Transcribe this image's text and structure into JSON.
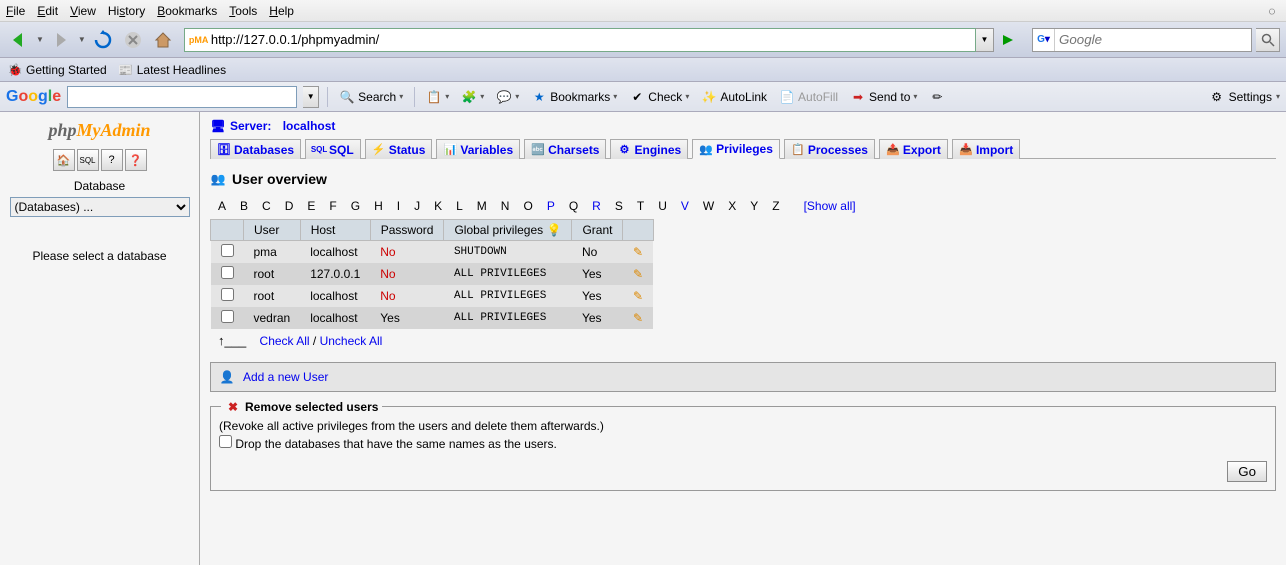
{
  "menu": {
    "file": "File",
    "edit": "Edit",
    "view": "View",
    "history": "History",
    "bookmarks": "Bookmarks",
    "tools": "Tools",
    "help": "Help"
  },
  "nav": {
    "url": "http://127.0.0.1/phpmyadmin/",
    "search_placeholder": "Google"
  },
  "bookmarks": {
    "getting_started": "Getting Started",
    "latest": "Latest Headlines"
  },
  "gbar": {
    "search": "Search",
    "bookmarks": "Bookmarks",
    "check": "Check",
    "autolink": "AutoLink",
    "autofill": "AutoFill",
    "sendto": "Send to",
    "settings": "Settings"
  },
  "sidebar": {
    "db_label": "Database",
    "db_select": "(Databases) ...",
    "hint": "Please select a database"
  },
  "server": {
    "label": "Server:",
    "name": "localhost"
  },
  "tabs": {
    "databases": "Databases",
    "sql": "SQL",
    "status": "Status",
    "variables": "Variables",
    "charsets": "Charsets",
    "engines": "Engines",
    "privileges": "Privileges",
    "processes": "Processes",
    "export": "Export",
    "import": "Import"
  },
  "overview": {
    "title": "User overview",
    "show_all": "[Show all]",
    "letters": [
      "A",
      "B",
      "C",
      "D",
      "E",
      "F",
      "G",
      "H",
      "I",
      "J",
      "K",
      "L",
      "M",
      "N",
      "O",
      "P",
      "Q",
      "R",
      "S",
      "T",
      "U",
      "V",
      "W",
      "X",
      "Y",
      "Z"
    ],
    "letter_links": [
      "P",
      "R",
      "V"
    ],
    "headers": {
      "user": "User",
      "host": "Host",
      "password": "Password",
      "global": "Global privileges",
      "grant": "Grant"
    },
    "rows": [
      {
        "user": "pma",
        "host": "localhost",
        "password": "No",
        "pw_red": true,
        "global": "SHUTDOWN",
        "grant": "No"
      },
      {
        "user": "root",
        "host": "127.0.0.1",
        "password": "No",
        "pw_red": true,
        "global": "ALL PRIVILEGES",
        "grant": "Yes"
      },
      {
        "user": "root",
        "host": "localhost",
        "password": "No",
        "pw_red": true,
        "global": "ALL PRIVILEGES",
        "grant": "Yes"
      },
      {
        "user": "vedran",
        "host": "localhost",
        "password": "Yes",
        "pw_red": false,
        "global": "ALL PRIVILEGES",
        "grant": "Yes"
      }
    ],
    "check_all": "Check All",
    "uncheck_all": "Uncheck All"
  },
  "adduser": {
    "label": "Add a new User"
  },
  "remove": {
    "legend": "Remove selected users",
    "desc": "(Revoke all active privileges from the users and delete them afterwards.)",
    "drop": "Drop the databases that have the same names as the users.",
    "go": "Go"
  }
}
